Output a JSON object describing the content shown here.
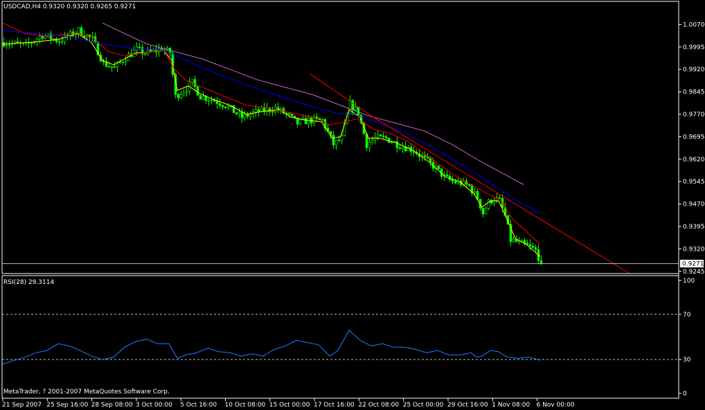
{
  "window": {
    "symbol_header": "USDCAD,H4  0.9320 0.9320 0.9265 0.9271",
    "copyright": "MetaTrader, ? 2001-2007 MetaQuotes Software Corp.",
    "current_price_tag": "0.9271"
  },
  "colors": {
    "background": "#000000",
    "frame": "#ffffff",
    "candle": "#00ff00",
    "ma_fast": "#ffff00",
    "ma_mid": "#ff0000",
    "ma_slow": "#0000ff",
    "ma_long": "#cc66cc",
    "trendline": "#ff0000",
    "rsi_line": "#1e7fff",
    "level_line": "#c0c0c0",
    "price_line": "#c0c0c0"
  },
  "chart_data": [
    {
      "type": "candlestick",
      "title": "USDCAD,H4",
      "ohlc_header": [
        "0.9320",
        "0.9320",
        "0.9265",
        "0.9271"
      ],
      "ylim": [
        0.924,
        1.0145
      ],
      "y_ticks": [
        "1.0070",
        "0.9995",
        "0.9920",
        "0.9845",
        "0.9770",
        "0.9695",
        "0.9620",
        "0.9545",
        "0.9470",
        "0.9395",
        "0.9320",
        "0.9245"
      ],
      "x_ticks": [
        "21 Sep 2007",
        "25 Sep 16:00",
        "28 Sep 08:00",
        "3 Oct 00:00",
        "5 Oct 16:00",
        "10 Oct 08:00",
        "15 Oct 00:00",
        "17 Oct 16:00",
        "22 Oct 08:00",
        "25 Oct 00:00",
        "29 Oct 16:00",
        "1 Nov 08:00",
        "6 Nov 00:00"
      ],
      "close_path": [
        [
          0,
          1.001
        ],
        [
          8,
          1.0
        ],
        [
          14,
          1.0035
        ],
        [
          20,
          1.0015
        ],
        [
          27,
          1.005
        ],
        [
          32,
          1.002
        ],
        [
          36,
          0.994
        ],
        [
          40,
          0.9925
        ],
        [
          44,
          0.996
        ],
        [
          48,
          0.9985
        ],
        [
          51,
          0.9975
        ],
        [
          54,
          0.998
        ],
        [
          57,
          0.999
        ],
        [
          60,
          0.9975
        ],
        [
          62,
          0.983
        ],
        [
          65,
          0.985
        ],
        [
          68,
          0.9875
        ],
        [
          71,
          0.983
        ],
        [
          75,
          0.982
        ],
        [
          80,
          0.98
        ],
        [
          86,
          0.976
        ],
        [
          92,
          0.978
        ],
        [
          98,
          0.979
        ],
        [
          102,
          0.977
        ],
        [
          106,
          0.974
        ],
        [
          110,
          0.975
        ],
        [
          115,
          0.975
        ],
        [
          119,
          0.967
        ],
        [
          122,
          0.969
        ],
        [
          125,
          0.9805
        ],
        [
          128,
          0.9775
        ],
        [
          131,
          0.967
        ],
        [
          134,
          0.969
        ],
        [
          138,
          0.969
        ],
        [
          142,
          0.967
        ],
        [
          148,
          0.965
        ],
        [
          152,
          0.962
        ],
        [
          156,
          0.959
        ],
        [
          159,
          0.956
        ],
        [
          162,
          0.9545
        ],
        [
          165,
          0.954
        ],
        [
          168,
          0.953
        ],
        [
          171,
          0.949
        ],
        [
          173,
          0.944
        ],
        [
          175,
          0.9475
        ],
        [
          177,
          0.949
        ],
        [
          179,
          0.948
        ],
        [
          181,
          0.943
        ],
        [
          183,
          0.935
        ],
        [
          186,
          0.934
        ],
        [
          189,
          0.933
        ],
        [
          192,
          0.9315
        ],
        [
          194,
          0.9271
        ]
      ],
      "series": [
        {
          "name": "",
          "color_key": "ma_fast",
          "points": [
            [
              0,
              1.0005
            ],
            [
              10,
              1.001
            ],
            [
              20,
              1.002
            ],
            [
              27,
              1.004
            ],
            [
              32,
              1.001
            ],
            [
              36,
              0.995
            ],
            [
              40,
              0.9935
            ],
            [
              44,
              0.9955
            ],
            [
              48,
              0.9975
            ],
            [
              52,
              0.9978
            ],
            [
              58,
              0.9985
            ],
            [
              61,
              0.995
            ],
            [
              63,
              0.985
            ],
            [
              67,
              0.9865
            ],
            [
              71,
              0.984
            ],
            [
              76,
              0.982
            ],
            [
              82,
              0.98
            ],
            [
              88,
              0.977
            ],
            [
              94,
              0.978
            ],
            [
              100,
              0.9785
            ],
            [
              104,
              0.976
            ],
            [
              110,
              0.975
            ],
            [
              115,
              0.9745
            ],
            [
              119,
              0.969
            ],
            [
              122,
              0.9695
            ],
            [
              125,
              0.9785
            ],
            [
              129,
              0.976
            ],
            [
              132,
              0.969
            ],
            [
              136,
              0.969
            ],
            [
              142,
              0.9675
            ],
            [
              148,
              0.965
            ],
            [
              154,
              0.961
            ],
            [
              160,
              0.956
            ],
            [
              165,
              0.9545
            ],
            [
              170,
              0.9505
            ],
            [
              173,
              0.946
            ],
            [
              176,
              0.948
            ],
            [
              179,
              0.948
            ],
            [
              182,
              0.942
            ],
            [
              185,
              0.9355
            ],
            [
              189,
              0.9335
            ],
            [
              194,
              0.9295
            ]
          ]
        },
        {
          "name": "",
          "color_key": "ma_mid",
          "points": [
            [
              0,
              1.0075
            ],
            [
              8,
              1.004
            ],
            [
              16,
              1.003
            ],
            [
              24,
              1.004
            ],
            [
              32,
              1.003
            ],
            [
              38,
              0.998
            ],
            [
              44,
              0.9965
            ],
            [
              50,
              0.9975
            ],
            [
              58,
              0.9985
            ],
            [
              62,
              0.992
            ],
            [
              66,
              0.9885
            ],
            [
              72,
              0.986
            ],
            [
              80,
              0.983
            ],
            [
              88,
              0.98
            ],
            [
              96,
              0.979
            ],
            [
              104,
              0.9775
            ],
            [
              112,
              0.976
            ],
            [
              118,
              0.9735
            ],
            [
              124,
              0.9745
            ],
            [
              128,
              0.9755
            ],
            [
              134,
              0.972
            ],
            [
              140,
              0.9705
            ],
            [
              146,
              0.968
            ],
            [
              152,
              0.964
            ],
            [
              158,
              0.96
            ],
            [
              164,
              0.956
            ],
            [
              170,
              0.953
            ],
            [
              176,
              0.95
            ],
            [
              180,
              0.948
            ],
            [
              184,
              0.942
            ],
            [
              190,
              0.937
            ],
            [
              194,
              0.9335
            ]
          ]
        },
        {
          "name": "",
          "color_key": "ma_slow",
          "points": [
            [
              0,
              1.005
            ],
            [
              12,
              1.004
            ],
            [
              24,
              1.003
            ],
            [
              36,
              1.0005
            ],
            [
              48,
              0.999
            ],
            [
              58,
              0.9985
            ],
            [
              64,
              0.996
            ],
            [
              72,
              0.9925
            ],
            [
              82,
              0.989
            ],
            [
              92,
              0.9855
            ],
            [
              100,
              0.983
            ],
            [
              110,
              0.98
            ],
            [
              120,
              0.9775
            ],
            [
              128,
              0.9765
            ],
            [
              136,
              0.974
            ],
            [
              146,
              0.9705
            ],
            [
              156,
              0.9655
            ],
            [
              166,
              0.96
            ],
            [
              176,
              0.954
            ],
            [
              184,
              0.949
            ],
            [
              194,
              0.944
            ]
          ]
        },
        {
          "name": "",
          "color_key": "ma_long",
          "points": [
            [
              36,
              1.0075
            ],
            [
              44,
              1.004
            ],
            [
              52,
              1.0005
            ],
            [
              62,
              0.998
            ],
            [
              72,
              0.9955
            ],
            [
              82,
              0.992
            ],
            [
              92,
              0.9885
            ],
            [
              102,
              0.986
            ],
            [
              112,
              0.9835
            ],
            [
              122,
              0.98
            ],
            [
              132,
              0.9765
            ],
            [
              142,
              0.974
            ],
            [
              152,
              0.9715
            ],
            [
              162,
              0.967
            ],
            [
              172,
              0.9615
            ],
            [
              182,
              0.9565
            ],
            [
              188,
              0.9535
            ]
          ]
        },
        {
          "name": "",
          "color_key": "trendline",
          "points": [
            [
              111,
              0.9905
            ],
            [
              133,
              0.9765
            ],
            [
              185,
              0.947
            ],
            [
              226,
              0.924
            ]
          ]
        }
      ]
    },
    {
      "type": "line",
      "title": "RSI(28) 29.3114",
      "ylim": [
        0,
        100
      ],
      "y_ticks": [
        "100",
        "70",
        "30",
        "0"
      ],
      "levels": [
        70,
        30
      ],
      "series": [
        {
          "name": "RSI(28)",
          "points": [
            [
              0,
              26
            ],
            [
              4,
              29
            ],
            [
              8,
              32
            ],
            [
              12,
              36
            ],
            [
              16,
              38
            ],
            [
              20,
              44
            ],
            [
              24,
              42
            ],
            [
              28,
              38
            ],
            [
              32,
              33
            ],
            [
              36,
              30
            ],
            [
              40,
              32
            ],
            [
              44,
              41
            ],
            [
              48,
              46
            ],
            [
              52,
              48
            ],
            [
              56,
              44
            ],
            [
              60,
              44
            ],
            [
              63,
              31
            ],
            [
              66,
              34
            ],
            [
              70,
              36
            ],
            [
              74,
              40
            ],
            [
              78,
              37
            ],
            [
              82,
              36
            ],
            [
              86,
              33
            ],
            [
              90,
              35
            ],
            [
              94,
              33
            ],
            [
              98,
              39
            ],
            [
              102,
              42
            ],
            [
              106,
              47
            ],
            [
              110,
              45
            ],
            [
              114,
              43
            ],
            [
              118,
              33
            ],
            [
              121,
              38
            ],
            [
              125,
              56
            ],
            [
              129,
              47
            ],
            [
              133,
              42
            ],
            [
              137,
              44
            ],
            [
              141,
              41
            ],
            [
              145,
              41
            ],
            [
              149,
              39
            ],
            [
              153,
              36
            ],
            [
              157,
              38
            ],
            [
              161,
              34
            ],
            [
              165,
              34
            ],
            [
              169,
              36
            ],
            [
              171,
              32
            ],
            [
              173,
              33
            ],
            [
              176,
              38
            ],
            [
              179,
              37
            ],
            [
              182,
              32
            ],
            [
              186,
              31
            ],
            [
              190,
              32
            ],
            [
              194,
              29.3
            ]
          ]
        }
      ]
    }
  ]
}
